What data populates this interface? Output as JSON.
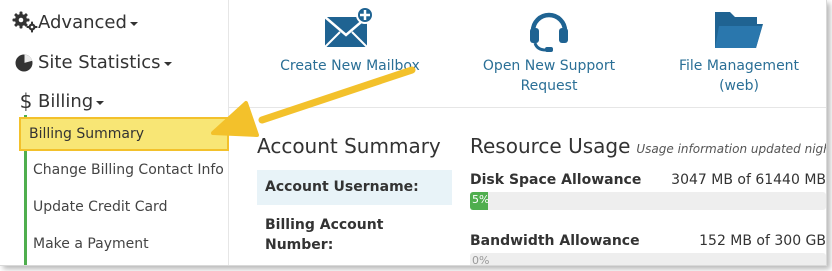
{
  "sidebar": {
    "groups": [
      {
        "label": "Advanced",
        "icon": "gears-icon"
      },
      {
        "label": "Site Statistics",
        "icon": "pie-chart-icon"
      },
      {
        "label": "Billing",
        "icon": "dollar-icon"
      }
    ],
    "billing_items": [
      {
        "label": "Billing Summary",
        "active": true
      },
      {
        "label": "Change Billing Contact Info"
      },
      {
        "label": "Update Credit Card"
      },
      {
        "label": "Make a Payment"
      }
    ]
  },
  "quick_links": [
    {
      "line1": "Create New Mailbox",
      "line2": "",
      "icon": "envelope-plus-icon"
    },
    {
      "line1": "Open New Support",
      "line2": "Request",
      "icon": "headset-icon"
    },
    {
      "line1": "File Management (web)",
      "line2": "",
      "icon": "folder-open-icon"
    }
  ],
  "account_summary": {
    "title": "Account Summary",
    "username_label": "Account Username:",
    "billing_number_label": "Billing Account Number:"
  },
  "resource_usage": {
    "title": "Resource Usage",
    "subtitle": "Usage information updated nightly",
    "disk": {
      "label": "Disk Space Allowance",
      "value": "3047 MB of 61440 MB",
      "percent": 5,
      "percent_label": "5%"
    },
    "bandwidth": {
      "label": "Bandwidth Allowance",
      "value": "152 MB of 300 GB",
      "percent": 0,
      "percent_label": "0%"
    }
  },
  "colors": {
    "accent_green": "#4fae4e",
    "link_blue": "#2a6f96",
    "icon_blue": "#1f6392",
    "highlight_yellow": "#f8e675",
    "arrow_yellow": "#f3c12b"
  }
}
